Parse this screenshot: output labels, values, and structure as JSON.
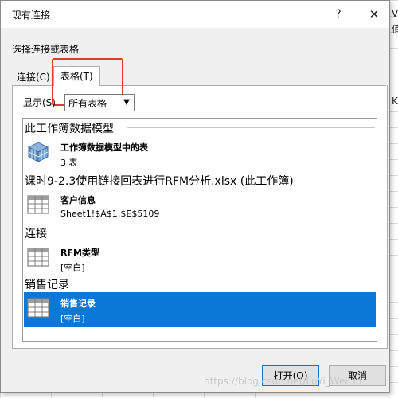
{
  "background": {
    "cells": [
      "V",
      "值",
      "K"
    ]
  },
  "dialog": {
    "title": "现有连接",
    "help_glyph": "?",
    "close_glyph": "✕",
    "prompt": "选择连接或表格",
    "tabs": [
      {
        "label": "连接(C)"
      },
      {
        "label": "表格(T)"
      }
    ],
    "show_label": "显示(S)",
    "show_value": "所有表格",
    "groups": [
      {
        "heading": "此工作簿数据模型",
        "items": [
          {
            "name": "工作簿数据模型中的表",
            "desc": "3 表",
            "icon": "cube-icon"
          }
        ]
      },
      {
        "heading": "课时9-2.3使用链接回表进行RFM分析.xlsx (此工作簿)",
        "items": [
          {
            "name": "客户信息",
            "desc": "Sheet1!$A$1:$E$5109",
            "icon": "table-icon"
          }
        ]
      },
      {
        "heading": "连接",
        "items": [
          {
            "name": "RFM类型",
            "desc": "[空白]",
            "icon": "table-icon"
          }
        ]
      },
      {
        "heading": "销售记录",
        "items": [
          {
            "name": "销售记录",
            "desc": "[空白]",
            "icon": "table-icon",
            "selected": true
          }
        ]
      }
    ],
    "buttons": {
      "open": "打开(O)",
      "cancel": "取消"
    }
  },
  "watermark": "https://blog.csdn.net/LuYi_WeiLin"
}
